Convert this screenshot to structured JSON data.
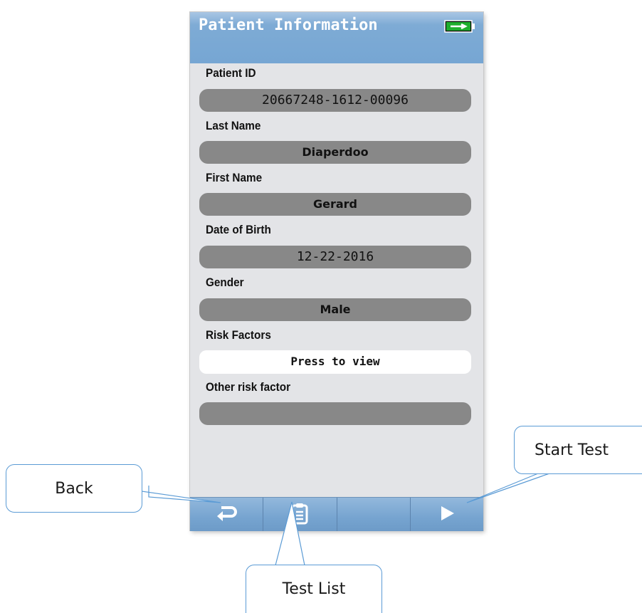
{
  "screen": {
    "title": "Patient Information",
    "battery_icon": "battery-charging-icon",
    "fields": [
      {
        "label": "Patient ID",
        "value": "20667248-1612-00096"
      },
      {
        "label": "Last Name",
        "value": "Diaperdoo"
      },
      {
        "label": "First Name",
        "value": "Gerard"
      },
      {
        "label": "Date of Birth",
        "value": "12-22-2016"
      },
      {
        "label": "Gender",
        "value": "Male"
      },
      {
        "label": "Risk Factors",
        "value": "Press to view"
      },
      {
        "label": "Other risk factor",
        "value": ""
      }
    ],
    "toolbar": {
      "buttons": [
        {
          "icon": "back-arrow-icon"
        },
        {
          "icon": "clipboard-icon"
        },
        {
          "icon": ""
        },
        {
          "icon": "play-icon"
        }
      ]
    }
  },
  "callouts": {
    "back": "Back",
    "test_list": "Test List",
    "start_test": "Start Test"
  },
  "colors": {
    "titlebar": "#7eabd5",
    "field_fill": "#888888",
    "screen_bg": "#e3e4e7",
    "callout_border": "#5b9bd5",
    "battery": "#22aa22"
  }
}
